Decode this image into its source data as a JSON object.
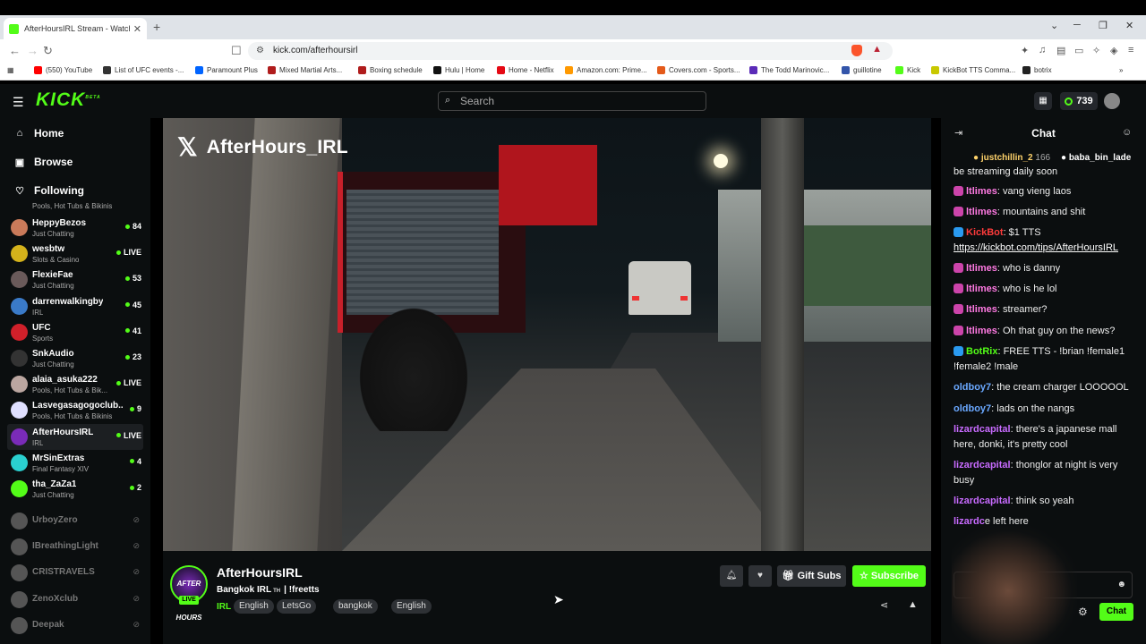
{
  "browser": {
    "tab_title": "AfterHoursIRL Stream - Watch",
    "url": "kick.com/afterhoursirl",
    "bookmarks": [
      {
        "label": "(550) YouTube",
        "color": "#ff0000"
      },
      {
        "label": "List of UFC events -...",
        "color": "#333333"
      },
      {
        "label": "Paramount Plus",
        "color": "#0064ff"
      },
      {
        "label": "Mixed Martial Arts...",
        "color": "#b01c1c"
      },
      {
        "label": "Boxing schedule",
        "color": "#b01c1c"
      },
      {
        "label": "Hulu | Home",
        "color": "#111111"
      },
      {
        "label": "Home - Netflix",
        "color": "#e50914"
      },
      {
        "label": "Amazon.com: Prime...",
        "color": "#ff9900"
      },
      {
        "label": "Covers.com - Sports...",
        "color": "#e45a1a"
      },
      {
        "label": "The Todd Marinovic...",
        "color": "#5b2bb8"
      },
      {
        "label": "guillotine",
        "color": "#3355aa"
      },
      {
        "label": "Kick",
        "color": "#53fc18"
      },
      {
        "label": "KickBot TTS Comma...",
        "color": "#c8c800"
      },
      {
        "label": "botrix",
        "color": "#222222"
      }
    ]
  },
  "header": {
    "logo": "KICK",
    "logo_sup": "BETA",
    "search_placeholder": "Search",
    "points": "739"
  },
  "sidebar": {
    "nav": [
      {
        "label": "Home",
        "icon": "home-icon",
        "glyph": "⌂"
      },
      {
        "label": "Browse",
        "icon": "browse-icon",
        "glyph": "▣"
      },
      {
        "label": "Following",
        "icon": "heart-icon",
        "glyph": "♡"
      }
    ],
    "partial_category": "Pools, Hot Tubs & Bikinis",
    "channels": [
      {
        "name": "HeppyBezos",
        "category": "Just Chatting",
        "viewers": "84",
        "color": "#c97a5a"
      },
      {
        "name": "wesbtw",
        "category": "Slots & Casino",
        "viewers": "LIVE",
        "color": "#d4b21b"
      },
      {
        "name": "FlexieFae",
        "category": "Just Chatting",
        "viewers": "53",
        "color": "#6a5a5a"
      },
      {
        "name": "darrenwalkingby",
        "category": "IRL",
        "viewers": "45",
        "color": "#3a7ac8"
      },
      {
        "name": "UFC",
        "category": "Sports",
        "viewers": "41",
        "color": "#d0202a"
      },
      {
        "name": "SnkAudio",
        "category": "Just Chatting",
        "viewers": "23",
        "color": "#333333"
      },
      {
        "name": "alaia_asuka222",
        "category": "Pools, Hot Tubs & Bik...",
        "viewers": "LIVE",
        "color": "#bba6a0"
      },
      {
        "name": "Lasvegasagogoclub...",
        "category": "Pools, Hot Tubs & Bikinis",
        "viewers": "9",
        "color": "#e0e0ff"
      },
      {
        "name": "AfterHoursIRL",
        "category": "IRL",
        "viewers": "LIVE",
        "color": "#7a2bb8"
      },
      {
        "name": "MrSinExtras",
        "category": "Final Fantasy XIV",
        "viewers": "4",
        "color": "#2ad0d0"
      },
      {
        "name": "tha_ZaZa1",
        "category": "Just Chatting",
        "viewers": "2",
        "color": "#53fc18"
      }
    ],
    "offline": [
      "UrboyZero",
      "IBreathingLight",
      "CRISTRAVELS",
      "ZenoXclub",
      "Deepak"
    ]
  },
  "video": {
    "watermark": "AfterHours_IRL"
  },
  "stream": {
    "channel": "AfterHoursIRL",
    "avatar_text": "AFTER HOURS",
    "live": "LIVE",
    "title": "Bangkok IRL",
    "flag": "TH",
    "title_sep": "|",
    "title_cmd": "!freetts",
    "category": "IRL",
    "tags": [
      "English",
      "LetsGo",
      "bangkok",
      "English"
    ],
    "gift_label": "Gift Subs",
    "subscribe_label": "Subscribe"
  },
  "chat": {
    "title": "Chat",
    "pinned": [
      {
        "user": "justchillin_2",
        "count": "166"
      },
      {
        "user": "baba_bin_lade"
      }
    ],
    "messages": [
      {
        "user": "",
        "text": "be streaming daily soon",
        "color": "#ff7ae3"
      },
      {
        "user": "ltlimes",
        "text": ": vang vieng laos",
        "color": "#ff7ae3",
        "badge": "#cc44aa"
      },
      {
        "user": "ltlimes",
        "text": ": mountains and shit",
        "color": "#ff7ae3",
        "badge": "#cc44aa"
      },
      {
        "user": "KickBot",
        "text": ": $1 TTS",
        "color": "#ff3b3b",
        "badge": "#2a9af0",
        "link": "https://kickbot.com/tips/AfterHoursIRL"
      },
      {
        "user": "ltlimes",
        "text": ": who is danny",
        "color": "#ff7ae3",
        "badge": "#cc44aa"
      },
      {
        "user": "ltlimes",
        "text": ": who is he lol",
        "color": "#ff7ae3",
        "badge": "#cc44aa"
      },
      {
        "user": "ltlimes",
        "text": ": streamer?",
        "color": "#ff7ae3",
        "badge": "#cc44aa"
      },
      {
        "user": "ltlimes",
        "text": ": Oh that guy on the news?",
        "color": "#ff7ae3",
        "badge": "#cc44aa"
      },
      {
        "user": "BotRix",
        "text": ": FREE TTS - !brian !female1 !female2 !male",
        "color": "#53fc18",
        "badge": "#2a9af0"
      },
      {
        "user": "oldboy7",
        "text": ": the cream charger LOOOOOL",
        "color": "#6aa8ff"
      },
      {
        "user": "oldboy7",
        "text": ": lads on the nangs",
        "color": "#6aa8ff"
      },
      {
        "user": "lizardcapital",
        "text": ": there's a japanese mall here, donki, it's pretty cool",
        "color": "#c86bff"
      },
      {
        "user": "lizardcapital",
        "text": ": thonglor at night is very busy",
        "color": "#c86bff"
      },
      {
        "user": "lizardcapital",
        "text": ": think so yeah",
        "color": "#c86bff"
      },
      {
        "user": "lizardc",
        "text": "e left here",
        "color": "#c86bff"
      }
    ],
    "send_label": "Chat"
  }
}
